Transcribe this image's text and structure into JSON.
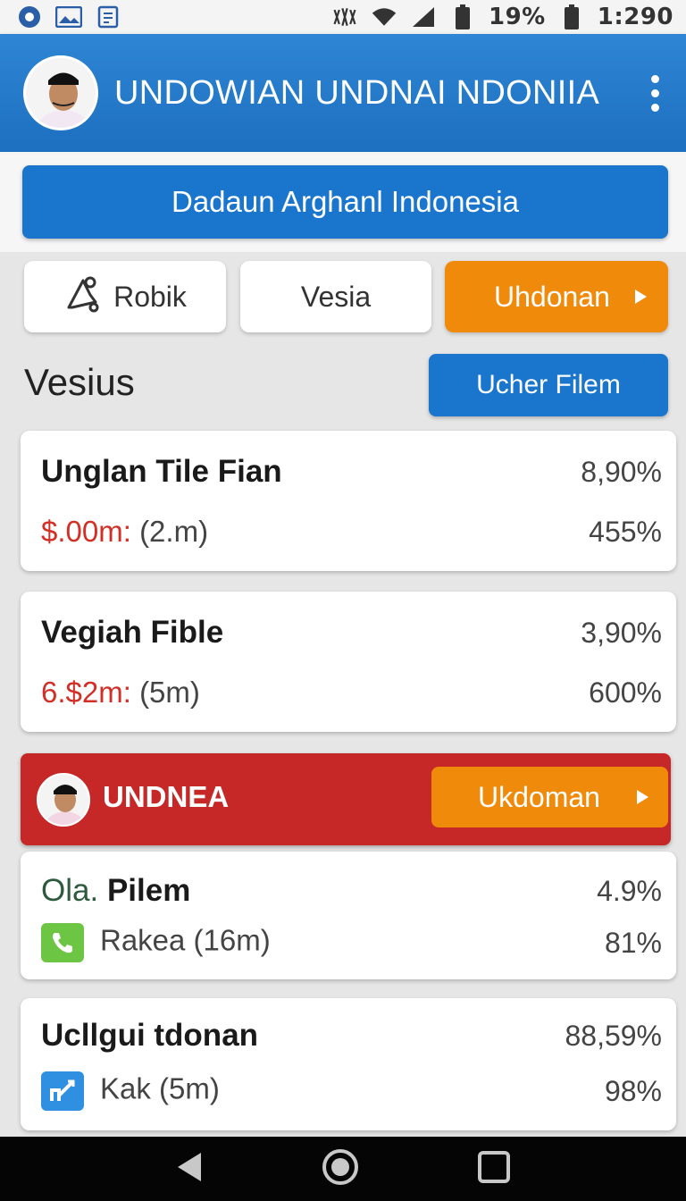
{
  "status_bar": {
    "battery": "19%",
    "time": "1:290"
  },
  "app_bar": {
    "title": "UNDOWIAN UNDNAI NDONIIA"
  },
  "banner": {
    "label": "Dadaun Arghanl Indonesia"
  },
  "chips": [
    {
      "label": "Robik",
      "icon": "bell-icon"
    },
    {
      "label": "Vesia"
    },
    {
      "label": "Uhdonan",
      "icon": "play-triangle-icon"
    }
  ],
  "section": {
    "title": "Vesius",
    "filter_button": "Ucher Filem"
  },
  "cards": [
    {
      "title": "Unglan Tile Fian",
      "pct_top": "8,90%",
      "sub_red": "$.00m:",
      "sub_rest": "(2.m)",
      "pct_bottom": "455%"
    },
    {
      "title": "Vegiah Fible",
      "pct_top": "3,90%",
      "sub_red": "6.$2m:",
      "sub_rest": "(5m)",
      "pct_bottom": "600%"
    }
  ],
  "promo": {
    "label": "UNDNEA",
    "button": "Ukdoman"
  },
  "cards_lower": [
    {
      "title_prefix": "Ola.",
      "title": "Pilem",
      "pct_top": "4.9%",
      "sub": "Rakea (16m)",
      "pct_bottom": "81%",
      "icon": "phone-icon",
      "icon_color": "#6cc644"
    },
    {
      "title": "Ucllgui tdonan",
      "pct_top": "88,59%",
      "sub": "Kak (5m)",
      "pct_bottom": "98%",
      "icon": "chart-icon",
      "icon_color": "#2f8fe0"
    }
  ],
  "colors": {
    "primary_blue": "#1a76cc",
    "orange": "#f08a0a",
    "red": "#c62828"
  }
}
